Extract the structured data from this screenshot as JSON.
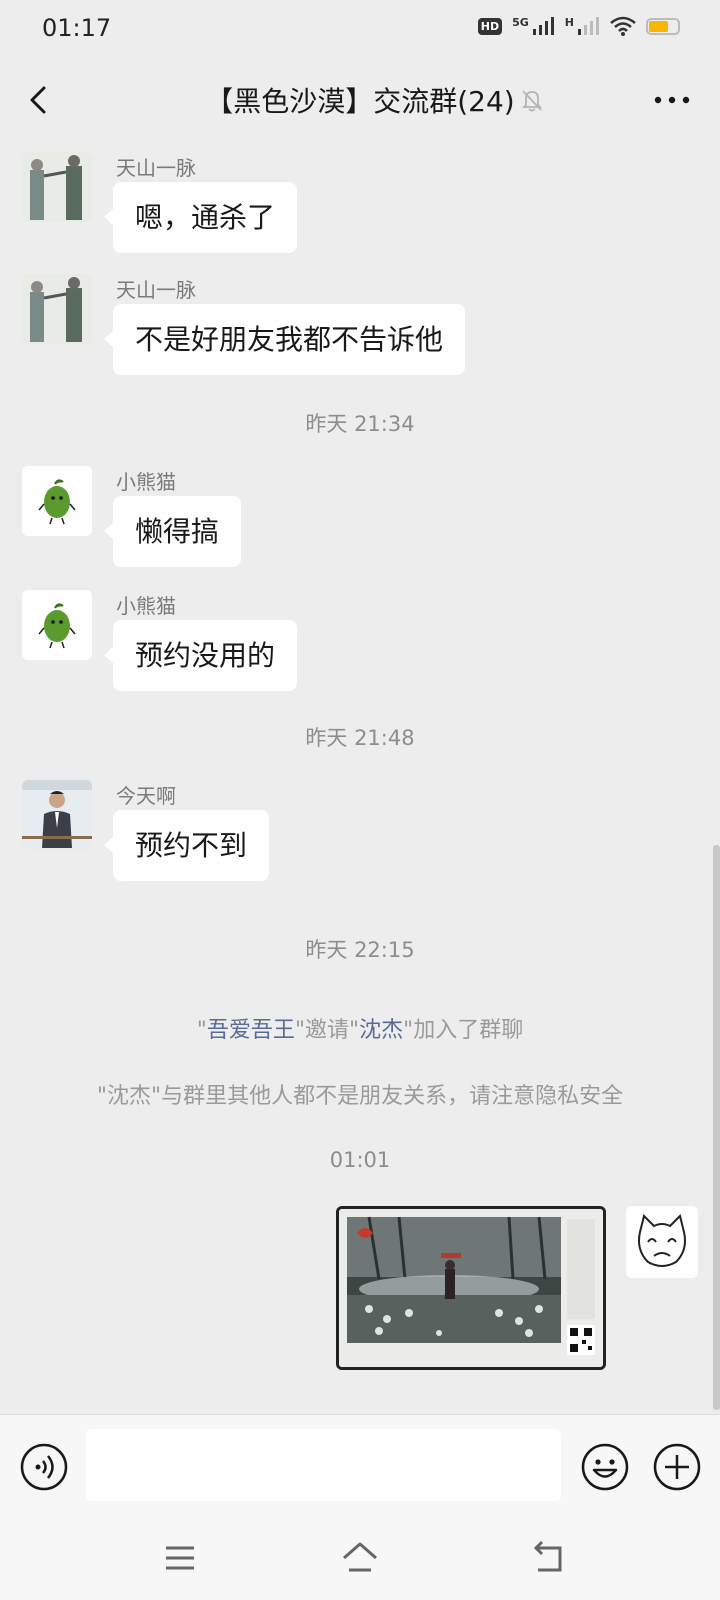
{
  "status_bar": {
    "time": "01:17",
    "hd_label": "HD",
    "net_5g": "5G",
    "net_h": "H",
    "battery_level": 0.7,
    "battery_color": "#f5b700"
  },
  "header": {
    "title": "【黑色沙漠】交流群(24)",
    "back_icon": "chevron-left-icon",
    "mute_icon": "bell-off-icon",
    "more_icon": "more-dots-icon"
  },
  "messages": [
    {
      "sender": "天山一脉",
      "text": "嗯，通杀了",
      "avatar": "avatar-tianshan"
    },
    {
      "sender": "天山一脉",
      "text": "不是好朋友我都不告诉他",
      "avatar": "avatar-tianshan"
    },
    {
      "sender": "小熊猫",
      "text": "懒得搞",
      "avatar": "avatar-green-cartoon"
    },
    {
      "sender": "小熊猫",
      "text": "预约没用的",
      "avatar": "avatar-green-cartoon"
    },
    {
      "sender": "今天啊",
      "text": "预约不到",
      "avatar": "avatar-man-suit"
    }
  ],
  "timestamps": {
    "t1": "昨天 21:34",
    "t2": "昨天 21:48",
    "t3": "昨天 22:15",
    "t4": "01:01"
  },
  "system_notes": {
    "invite": {
      "q1": "\"",
      "inviter": "吾爱吾王",
      "mid": "\"邀请\"",
      "invitee": "沈杰",
      "end": "\"加入了群聊"
    },
    "privacy": "\"沈杰\"与群里其他人都不是朋友关系，请注意隐私安全"
  },
  "my_message": {
    "type": "image",
    "description_icon": "game-screenshot-image"
  },
  "input_bar": {
    "placeholder": "",
    "voice_icon": "voice-icon",
    "emoji_icon": "emoji-icon",
    "plus_icon": "plus-icon"
  },
  "colors": {
    "background": "#ededed",
    "bubble": "#ffffff",
    "link": "#576b95"
  }
}
